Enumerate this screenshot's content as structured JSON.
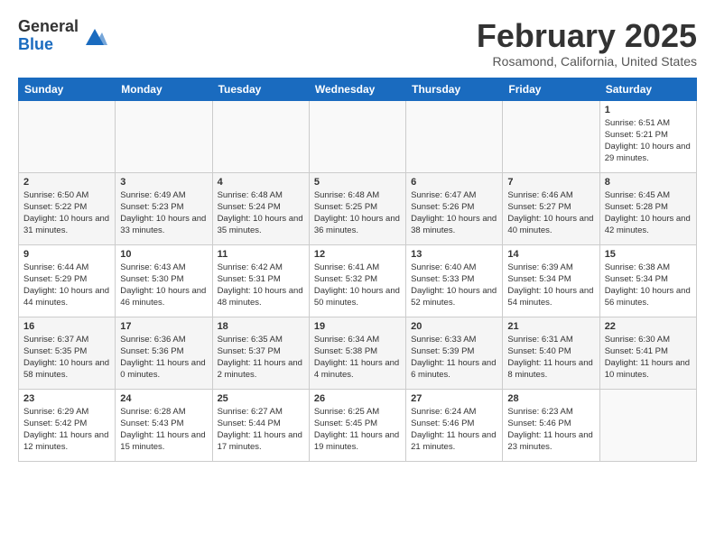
{
  "header": {
    "logo_general": "General",
    "logo_blue": "Blue",
    "month_title": "February 2025",
    "location": "Rosamond, California, United States"
  },
  "weekdays": [
    "Sunday",
    "Monday",
    "Tuesday",
    "Wednesday",
    "Thursday",
    "Friday",
    "Saturday"
  ],
  "weeks": [
    [
      {
        "day": "",
        "info": ""
      },
      {
        "day": "",
        "info": ""
      },
      {
        "day": "",
        "info": ""
      },
      {
        "day": "",
        "info": ""
      },
      {
        "day": "",
        "info": ""
      },
      {
        "day": "",
        "info": ""
      },
      {
        "day": "1",
        "info": "Sunrise: 6:51 AM\nSunset: 5:21 PM\nDaylight: 10 hours and 29 minutes."
      }
    ],
    [
      {
        "day": "2",
        "info": "Sunrise: 6:50 AM\nSunset: 5:22 PM\nDaylight: 10 hours and 31 minutes."
      },
      {
        "day": "3",
        "info": "Sunrise: 6:49 AM\nSunset: 5:23 PM\nDaylight: 10 hours and 33 minutes."
      },
      {
        "day": "4",
        "info": "Sunrise: 6:48 AM\nSunset: 5:24 PM\nDaylight: 10 hours and 35 minutes."
      },
      {
        "day": "5",
        "info": "Sunrise: 6:48 AM\nSunset: 5:25 PM\nDaylight: 10 hours and 36 minutes."
      },
      {
        "day": "6",
        "info": "Sunrise: 6:47 AM\nSunset: 5:26 PM\nDaylight: 10 hours and 38 minutes."
      },
      {
        "day": "7",
        "info": "Sunrise: 6:46 AM\nSunset: 5:27 PM\nDaylight: 10 hours and 40 minutes."
      },
      {
        "day": "8",
        "info": "Sunrise: 6:45 AM\nSunset: 5:28 PM\nDaylight: 10 hours and 42 minutes."
      }
    ],
    [
      {
        "day": "9",
        "info": "Sunrise: 6:44 AM\nSunset: 5:29 PM\nDaylight: 10 hours and 44 minutes."
      },
      {
        "day": "10",
        "info": "Sunrise: 6:43 AM\nSunset: 5:30 PM\nDaylight: 10 hours and 46 minutes."
      },
      {
        "day": "11",
        "info": "Sunrise: 6:42 AM\nSunset: 5:31 PM\nDaylight: 10 hours and 48 minutes."
      },
      {
        "day": "12",
        "info": "Sunrise: 6:41 AM\nSunset: 5:32 PM\nDaylight: 10 hours and 50 minutes."
      },
      {
        "day": "13",
        "info": "Sunrise: 6:40 AM\nSunset: 5:33 PM\nDaylight: 10 hours and 52 minutes."
      },
      {
        "day": "14",
        "info": "Sunrise: 6:39 AM\nSunset: 5:34 PM\nDaylight: 10 hours and 54 minutes."
      },
      {
        "day": "15",
        "info": "Sunrise: 6:38 AM\nSunset: 5:34 PM\nDaylight: 10 hours and 56 minutes."
      }
    ],
    [
      {
        "day": "16",
        "info": "Sunrise: 6:37 AM\nSunset: 5:35 PM\nDaylight: 10 hours and 58 minutes."
      },
      {
        "day": "17",
        "info": "Sunrise: 6:36 AM\nSunset: 5:36 PM\nDaylight: 11 hours and 0 minutes."
      },
      {
        "day": "18",
        "info": "Sunrise: 6:35 AM\nSunset: 5:37 PM\nDaylight: 11 hours and 2 minutes."
      },
      {
        "day": "19",
        "info": "Sunrise: 6:34 AM\nSunset: 5:38 PM\nDaylight: 11 hours and 4 minutes."
      },
      {
        "day": "20",
        "info": "Sunrise: 6:33 AM\nSunset: 5:39 PM\nDaylight: 11 hours and 6 minutes."
      },
      {
        "day": "21",
        "info": "Sunrise: 6:31 AM\nSunset: 5:40 PM\nDaylight: 11 hours and 8 minutes."
      },
      {
        "day": "22",
        "info": "Sunrise: 6:30 AM\nSunset: 5:41 PM\nDaylight: 11 hours and 10 minutes."
      }
    ],
    [
      {
        "day": "23",
        "info": "Sunrise: 6:29 AM\nSunset: 5:42 PM\nDaylight: 11 hours and 12 minutes."
      },
      {
        "day": "24",
        "info": "Sunrise: 6:28 AM\nSunset: 5:43 PM\nDaylight: 11 hours and 15 minutes."
      },
      {
        "day": "25",
        "info": "Sunrise: 6:27 AM\nSunset: 5:44 PM\nDaylight: 11 hours and 17 minutes."
      },
      {
        "day": "26",
        "info": "Sunrise: 6:25 AM\nSunset: 5:45 PM\nDaylight: 11 hours and 19 minutes."
      },
      {
        "day": "27",
        "info": "Sunrise: 6:24 AM\nSunset: 5:46 PM\nDaylight: 11 hours and 21 minutes."
      },
      {
        "day": "28",
        "info": "Sunrise: 6:23 AM\nSunset: 5:46 PM\nDaylight: 11 hours and 23 minutes."
      },
      {
        "day": "",
        "info": ""
      }
    ]
  ]
}
